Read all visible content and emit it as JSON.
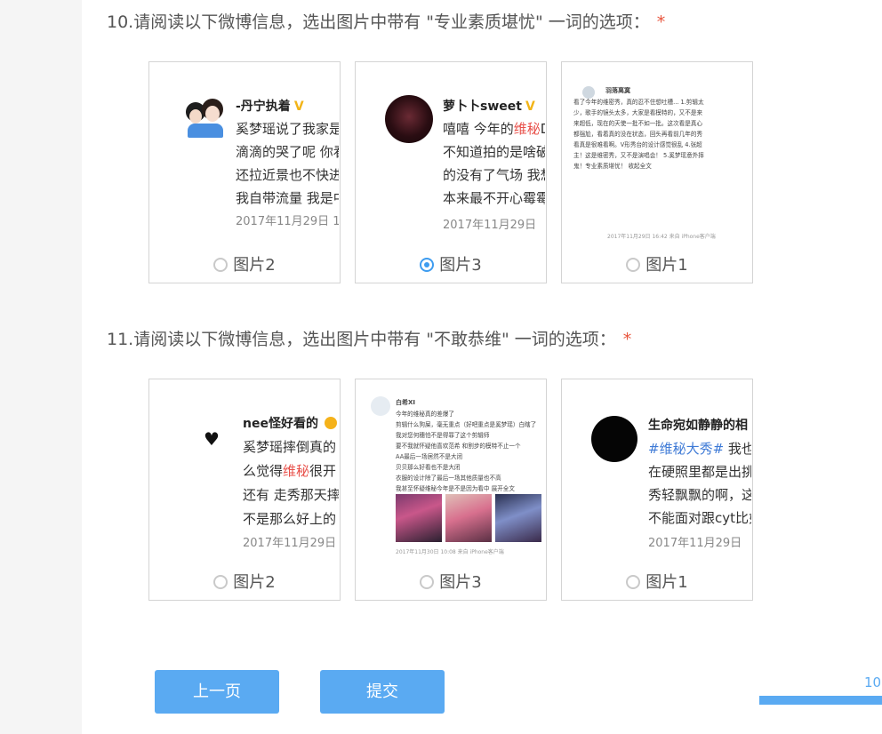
{
  "questions": [
    {
      "title": "10.请阅读以下微博信息，选出图片中带有 \"专业素质堪忧\" 一词的选项：",
      "required": "*",
      "options": [
        {
          "label": "图片2",
          "name": "-丹宁执着",
          "badge": "V",
          "lines": [
            "奚梦瑶说了我家是",
            "滴滴的哭了呢 你看",
            "还拉近景也不快进",
            "我自带流量 我是中"
          ],
          "date": "2017年11月29日 1"
        },
        {
          "label": "图片3",
          "selected": true,
          "name": "萝卜卜sweet",
          "badge": "V",
          "line1_a": "嘻嘻 今年的",
          "line1_hl": "维秘",
          "line1_b": "D",
          "lines": [
            "不知道拍的是啥破",
            "的没有了气场 我想",
            "本来最不开心霉霉"
          ],
          "date": "2017年11月29日"
        },
        {
          "label": "图片1",
          "name": "羽落离寞",
          "lines": [
            "看了今年的维密秀，真的忍不住想吐槽... 1.剪辑太",
            "少，歌手的镜头太多，大家是看模特的，又不是来",
            "来超低，现在的天使一批不如一批。这次看是真心",
            "都强尬，看着真的没在状态，回头再看前几年的秀",
            "看真是很难看啊。V形秀台的设计感觉很乱 4.张超",
            "主！这是维密秀，又不是演唱会！ 5.奚梦瑶意外摔",
            "鬼！专业素质堪忧！ 收起全文"
          ],
          "date": "2017年11月29日 16:42 来自 iPhone客户端"
        }
      ]
    },
    {
      "title": "11.请阅读以下微博信息，选出图片中带有 \"不敢恭维\" 一词的选项：",
      "required": "*",
      "options": [
        {
          "label": "图片2",
          "name": "nee怪好看的",
          "lines": [
            "奚梦瑶摔倒真的",
            "还有 走秀那天摔",
            "不是那么好上的"
          ],
          "line2_a": "么觉得",
          "line2_hl": "维秘",
          "line2_b": "很开",
          "date": "2017年11月29日"
        },
        {
          "label": "图片3",
          "name": "白希XI",
          "lines": [
            "今年的维秘真的差爆了",
            "剪辑什么狗屎，毫无重点（好吧重点是奚梦瑶）白瞎了",
            "我对您何穗怕不是得罪了这个剪辑师",
            "要不我就怀疑他喜欢范希 和割步的模特不止一个",
            "AA最后一场居然不是大闭",
            "贝贝那么好看也不是大闭",
            "衣服的设计除了最后一场其他质量也不高",
            "我甚至怀疑维秘今年是不是因为看中 展开全文"
          ],
          "date": "2017年11月30日 10:08 来自 iPhone客户端"
        },
        {
          "label": "图片1",
          "name": "生命宛如静静的相",
          "tag": "#维秘大秀#",
          "tag_after": " 我也是",
          "lines": [
            "在硬照里都是出挑",
            "秀轻飘飘的啊，这",
            "不能面对跟cyt比如"
          ],
          "date": "2017年11月29日"
        }
      ]
    }
  ],
  "buttons": {
    "prev": "上一页",
    "submit": "提交"
  },
  "progress": {
    "label": "10",
    "value_percent": 100
  },
  "colors": {
    "accent": "#5aaaf2",
    "required": "#e8553d",
    "highlight": "#e8504a"
  }
}
